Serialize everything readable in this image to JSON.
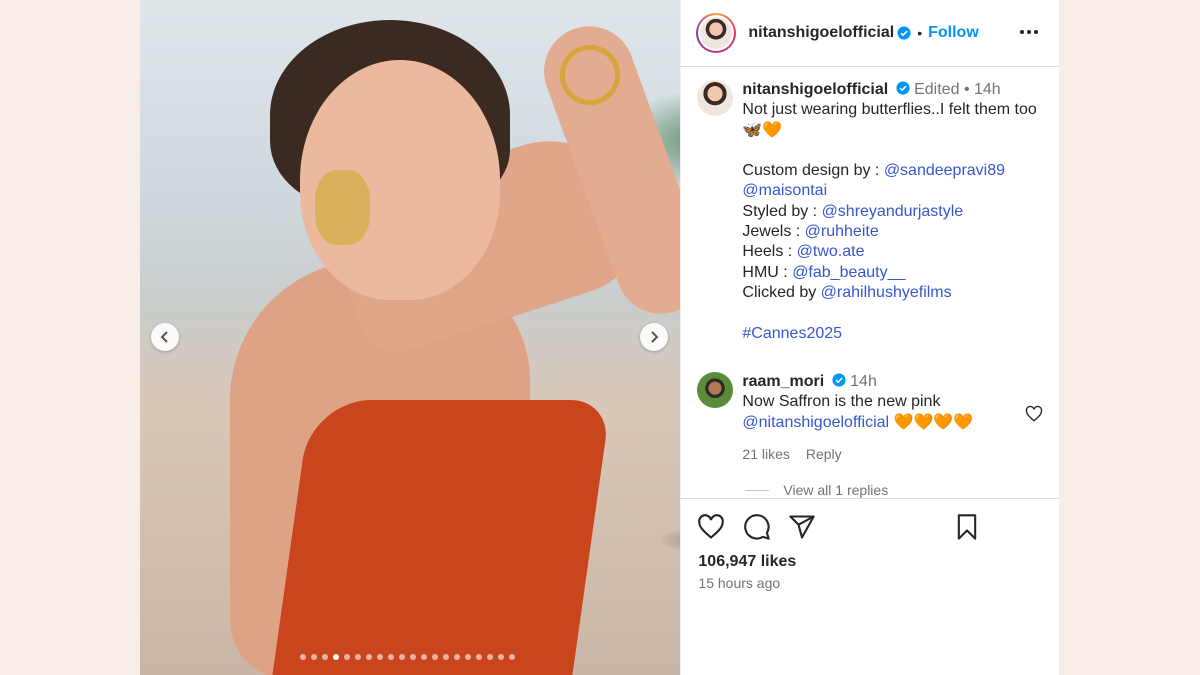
{
  "post": {
    "username": "nitanshigoelofficial",
    "follow_label": "Follow",
    "separator": "•"
  },
  "caption": {
    "username": "nitanshigoelofficial",
    "edited": "Edited",
    "time": "14h",
    "line1": "Not just wearing butterflies..I felt them too",
    "emojis": "🦋🧡",
    "custom_design_label": "Custom design by :",
    "custom_design_handle": "@sandeepravi89",
    "custom_design_handle2": "@maisontai",
    "styled_label": "Styled by :",
    "styled_handle": "@shreyandurjastyle",
    "jewels_label": "Jewels :",
    "jewels_handle": "@ruhheite",
    "heels_label": "Heels :",
    "heels_handle": "@two.ate",
    "hmu_label": "HMU :",
    "hmu_handle": "@fab_beauty__",
    "clicked_label": "Clicked by",
    "clicked_handle": "@rahilhushyefilms",
    "hashtag": "#Cannes2025"
  },
  "comment": {
    "username": "raam_mori",
    "time": "14h",
    "text": "Now Saffron is the new pink",
    "mention": "@nitanshigoelofficial",
    "emoji_tail": "🧡🧡🧡🧡",
    "likes": "21 likes",
    "reply_label": "Reply",
    "view_replies": "View all 1 replies"
  },
  "footer": {
    "likes": "106,947 likes",
    "time_ago": "15 hours ago"
  },
  "carousel": {
    "total_dots": 20,
    "active_index": 3
  },
  "colors": {
    "link": "#3557d1",
    "follow": "#0095f6",
    "verified": "#0095f6",
    "page_bg": "#f8ede7"
  },
  "icons": [
    "chevron-left-icon",
    "chevron-right-icon",
    "verified-icon",
    "more-icon",
    "heart-icon",
    "comment-icon",
    "share-icon",
    "bookmark-icon"
  ]
}
